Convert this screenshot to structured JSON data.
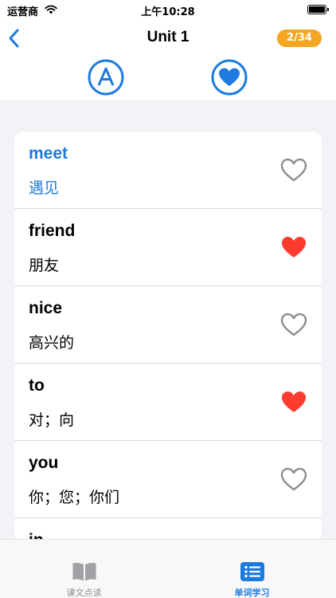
{
  "status_bar": {
    "carrier": "运营商",
    "time": "上午10:28"
  },
  "nav": {
    "title": "Unit 1",
    "progress": "2/34"
  },
  "colors": {
    "accent": "#1d7be0",
    "badge": "#f5a623",
    "heart_filled": "#ff3b30",
    "heart_outline": "#8e8e93"
  },
  "modes": [
    {
      "icon": "letter-a-circle-icon"
    },
    {
      "icon": "heart-circle-icon"
    }
  ],
  "words": [
    {
      "en": "meet",
      "cn": "遇见",
      "favorite": false,
      "active": true
    },
    {
      "en": "friend",
      "cn": "朋友",
      "favorite": true,
      "active": false
    },
    {
      "en": "nice",
      "cn": "高兴的",
      "favorite": false,
      "active": false
    },
    {
      "en": "to",
      "cn": "对；向",
      "favorite": true,
      "active": false
    },
    {
      "en": "you",
      "cn": "你；您；你们",
      "favorite": false,
      "active": false
    },
    {
      "en": "in",
      "cn": "",
      "favorite": false,
      "active": false
    }
  ],
  "tabs": [
    {
      "label": "课文点读",
      "icon": "book-icon",
      "selected": false
    },
    {
      "label": "单词学习",
      "icon": "list-icon",
      "selected": true
    }
  ]
}
